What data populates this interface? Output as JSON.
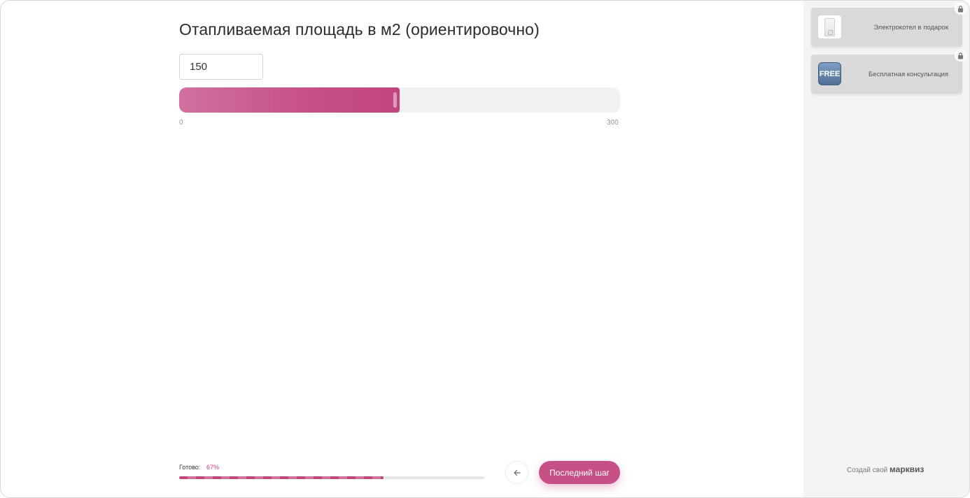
{
  "question": {
    "title": "Отапливаемая площадь в м2 (ориентировочно)"
  },
  "area_input": {
    "value": "150"
  },
  "slider": {
    "min": 0,
    "max": 300,
    "value": 150,
    "min_label": "0",
    "max_label": "300"
  },
  "progress": {
    "label": "Готово:",
    "percent_text": "67%",
    "percent": 67
  },
  "navigation": {
    "back_icon": "arrow-left-icon",
    "next_label": "Последний шаг"
  },
  "sidebar": {
    "bonuses": [
      {
        "label": "Электрокотел в подарок",
        "icon": "boiler-image"
      },
      {
        "label": "Бесплатная консультация",
        "icon": "free-badge",
        "badge_text": "FREE"
      }
    ],
    "lock_icon": "lock-icon",
    "footer_prefix": "Создай свой",
    "footer_brand": "марквиз"
  },
  "colors": {
    "accent": "#c64f86",
    "accent_light": "#d0719f",
    "sidebar_bg": "#f4f4f4",
    "card_bg": "#d9d9d9"
  }
}
